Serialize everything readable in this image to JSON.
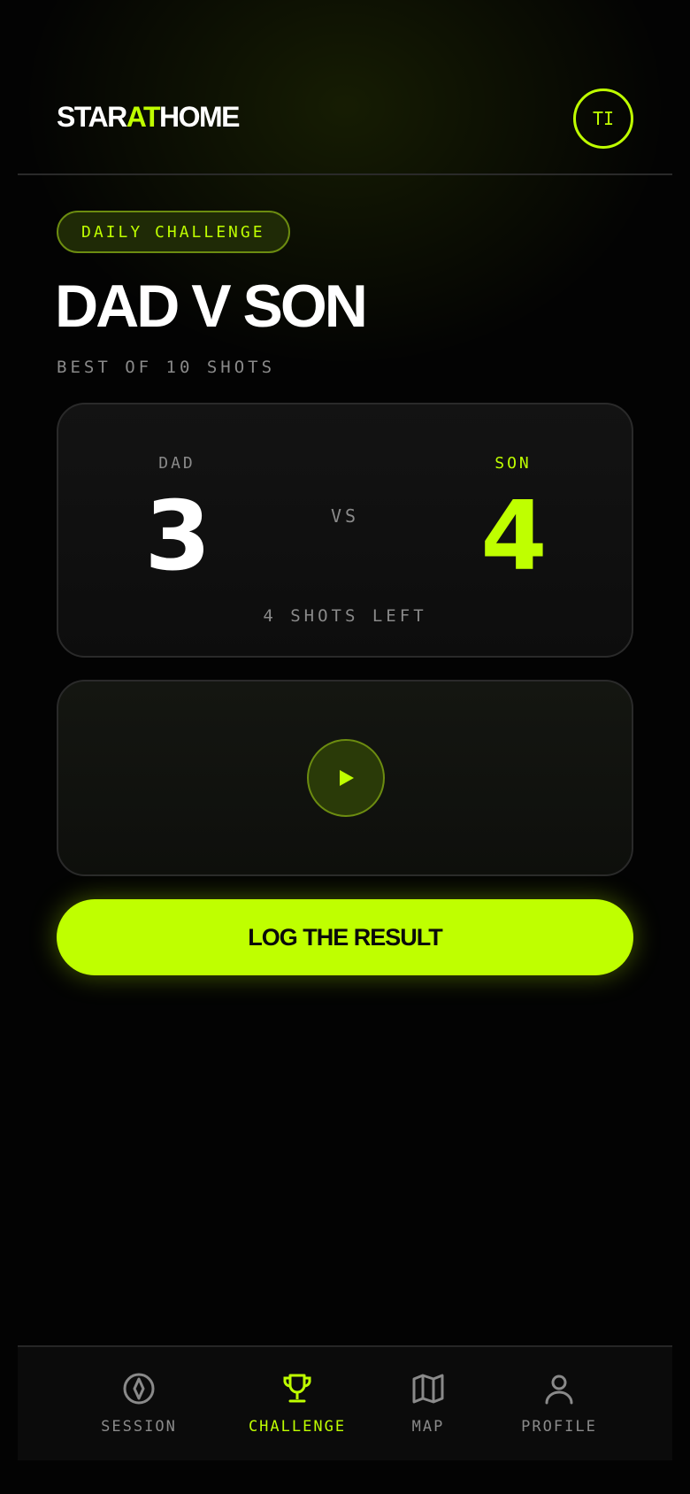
{
  "header": {
    "logo_part1": "STAR",
    "logo_part2": "AT",
    "logo_part3": "HOME",
    "avatar_initials": "TI"
  },
  "challenge": {
    "chip_label": "DAILY CHALLENGE",
    "title": "DAD V SON",
    "subtitle": "BEST OF 10 SHOTS"
  },
  "scoreboard": {
    "player1_name": "DAD",
    "player1_score": "3",
    "vs_label": "VS",
    "player2_name": "SON",
    "player2_score": "4",
    "shots_left": "4 SHOTS LEFT"
  },
  "video": {
    "play_icon": "play-icon"
  },
  "cta": {
    "label": "LOG THE RESULT"
  },
  "nav": {
    "items": [
      {
        "label": "SESSION",
        "icon": "compass-icon",
        "active": false
      },
      {
        "label": "CHALLENGE",
        "icon": "trophy-icon",
        "active": true
      },
      {
        "label": "MAP",
        "icon": "map-icon",
        "active": false
      },
      {
        "label": "PROFILE",
        "icon": "user-icon",
        "active": false
      }
    ]
  },
  "colors": {
    "accent": "#bfff00",
    "background": "#030303",
    "muted": "#8a8a8a"
  }
}
